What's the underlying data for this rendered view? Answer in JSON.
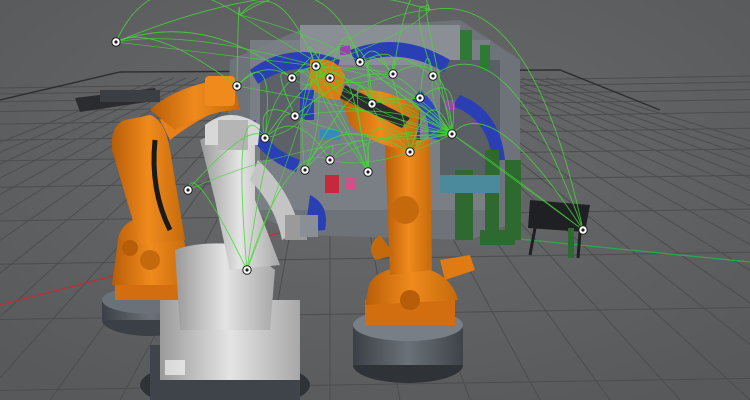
{
  "viewport": {
    "background": "#5e5f61",
    "grid_color": "#4c4d4f",
    "x_axis_color": "#b83232",
    "y_axis_color": "#2fa84a",
    "path_color": "#48d63a",
    "robot_orange": "#e07a12",
    "robot_grey": "#c9c9c9",
    "fixture_blue": "#2b3fb5",
    "base_dark": "#4a4f55"
  },
  "scene": {
    "robots": [
      {
        "id": "robot-left",
        "color": "orange"
      },
      {
        "id": "robot-center",
        "color": "grey"
      },
      {
        "id": "robot-right",
        "color": "orange"
      }
    ],
    "icons": [
      "waypoint-icon",
      "target-icon"
    ]
  }
}
